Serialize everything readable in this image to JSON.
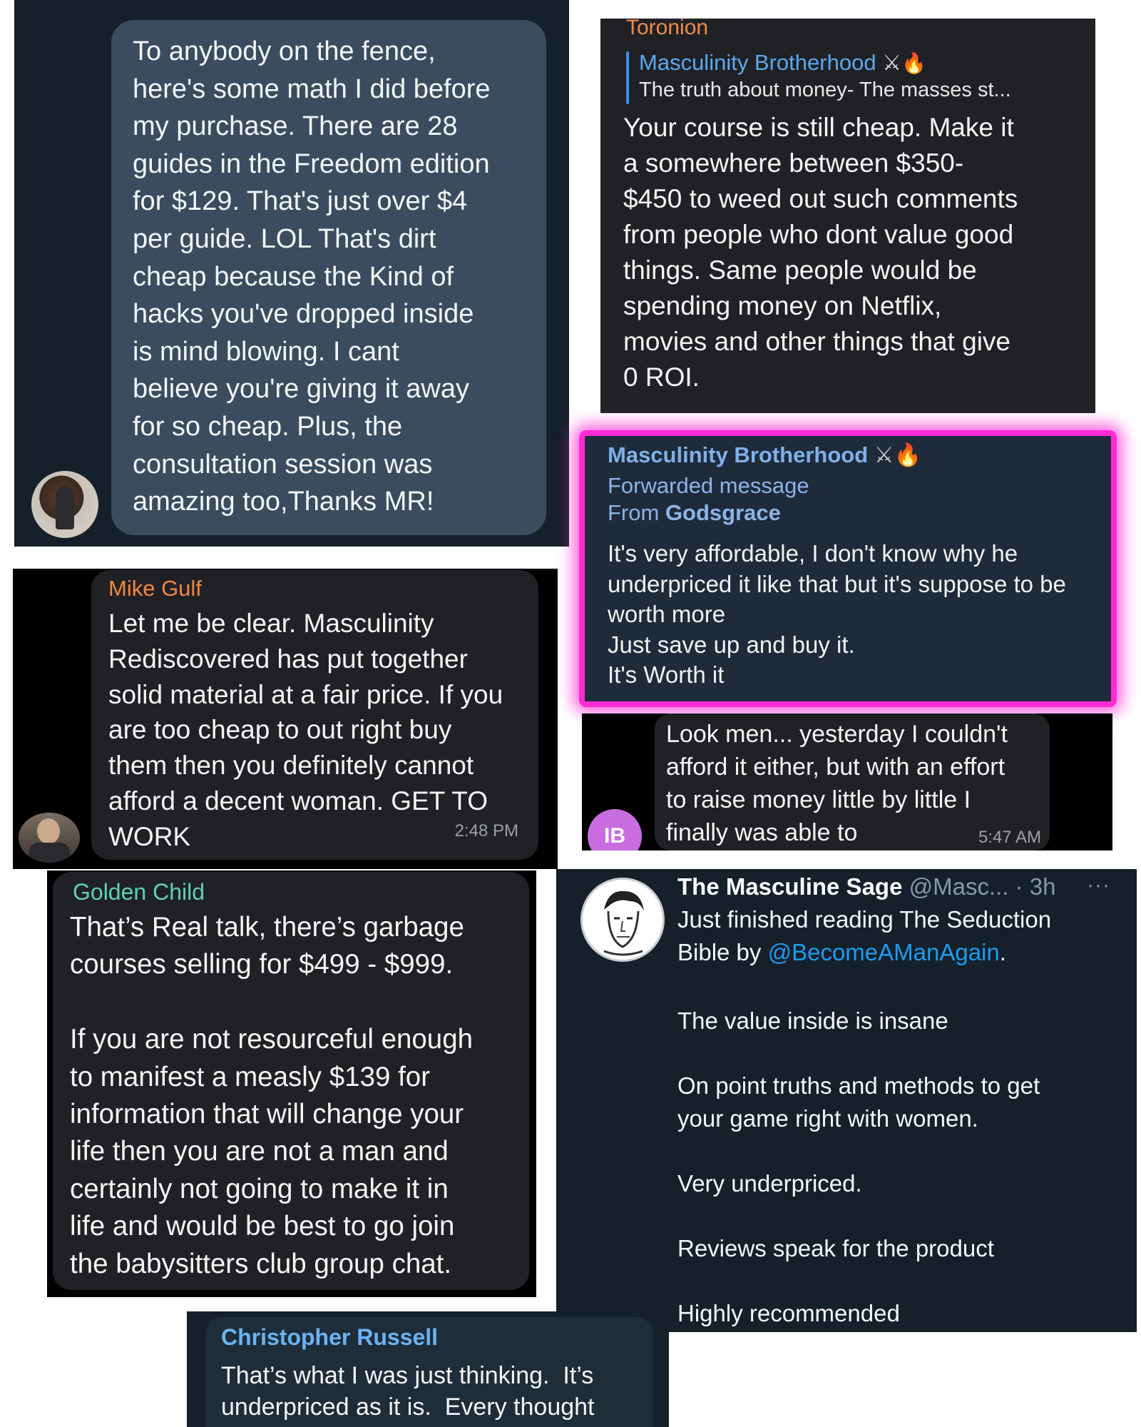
{
  "panel1": {
    "text": "To anybody on the fence,\nhere's some math I did before\nmy purchase. There are 28\nguides in the Freedom edition\nfor $129. That's just over $4\nper guide. LOL That's dirt\ncheap because the Kind of\nhacks you've dropped inside\nis mind blowing. I cant\nbelieve you're giving it away\nfor so cheap. Plus, the\nconsultation session was\namazing too,Thanks MR!"
  },
  "panel2": {
    "sender": "Toronion",
    "reply_channel": "Masculinity Brotherhood",
    "reply_preview": "The truth about money- The masses st...",
    "text": "Your course is still cheap. Make it\na somewhere between $350-\n$450 to weed out such comments\nfrom people who dont value good\nthings. Same people would be\nspending money on Netflix,\nmovies and other things that give\n0 ROI."
  },
  "panel3": {
    "channel": "Masculinity Brotherhood",
    "forwarded_label": "Forwarded message",
    "from_prefix": "From ",
    "from_name": "Godsgrace",
    "text": "It's very affordable, I don't know why he\nunderpriced it like that but it's suppose to be\nworth more\nJust save up and buy it.\nIt's Worth it"
  },
  "panel4": {
    "sender": "Mike Gulf",
    "text": "Let me be clear. Masculinity\nRediscovered has put together\nsolid material at a fair price. If you\nare too cheap to out right buy\nthem then you definitely cannot\nafford a decent woman. GET TO\nWORK",
    "time": "2:48 PM"
  },
  "panel5": {
    "avatar_initials": "IB",
    "text": "Look men... yesterday I couldn't\nafford it either, but with an effort\nto raise money little by little I\nfinally was able to",
    "time": "5:47 AM"
  },
  "panel6": {
    "sender": "Golden Child",
    "text": "That’s Real talk, there’s garbage\ncourses selling for $499 - $999.\n\nIf you are not resourceful enough\nto manifest a measly $139 for\ninformation that will change your\nlife then you are not a man and\ncertainly not going to make it in\nlife and would be best to go join\nthe babysitters club group chat."
  },
  "panel7": {
    "name": "The Masculine Sage",
    "handle": "@Masc...",
    "age": "· 3h",
    "more": "···",
    "line1": "Just finished reading The Seduction",
    "line2_prefix": "Bible by ",
    "mention": "@BecomeAManAgain",
    "line2_suffix": ".",
    "body": "The value inside is insane\n\nOn point truths and methods to get\nyour game right with women.\n\nVery underpriced.\n\nReviews speak for the product\n\nHighly recommended"
  },
  "panel8": {
    "sender": "Christopher Russell",
    "text": "That’s what I was just thinking.  It’s\nunderpriced as it is.  Every thought"
  },
  "icons": {
    "swords": "⚔",
    "fire": "🔥"
  },
  "colors": {
    "telegram_bubble": "#202124",
    "twitter_bubble": "#3b4c5f",
    "twitter_bg": "#15202b",
    "toronion": "#f08a4b",
    "mike_gulf": "#f0883e",
    "golden_child": "#5fd0b8",
    "link_blue": "#5aa9f0",
    "forward_blue": "#8cb4e8",
    "glow_pink": "#ff2bd6",
    "ib_avatar": "#c86de0"
  }
}
